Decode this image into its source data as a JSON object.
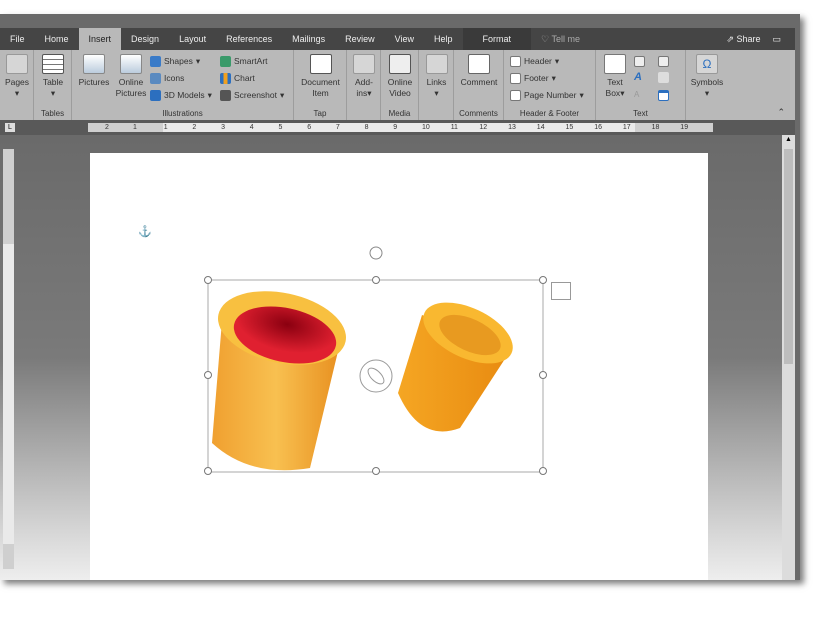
{
  "tabs": [
    "File",
    "Home",
    "Insert",
    "Design",
    "Layout",
    "References",
    "Mailings",
    "Review",
    "View",
    "Help",
    "Format"
  ],
  "active_tab": "Insert",
  "tell_me": "Tell me",
  "share": "Share",
  "ribbon": {
    "pages": {
      "label": "Pages",
      "group": ""
    },
    "tables": {
      "table": "Table",
      "group": "Tables"
    },
    "illustrations": {
      "pictures": "Pictures",
      "online_pictures": "Online Pictures",
      "shapes": "Shapes",
      "icons": "Icons",
      "models": "3D Models",
      "smartart": "SmartArt",
      "chart": "Chart",
      "screenshot": "Screenshot",
      "group": "Illustrations"
    },
    "tap": {
      "document_item": "Document Item",
      "group": "Tap"
    },
    "addins": {
      "label": "Add-ins",
      "group": ""
    },
    "media": {
      "online_video": "Online Video",
      "group": "Media"
    },
    "links": {
      "label": "Links",
      "group": ""
    },
    "comments": {
      "comment": "Comment",
      "group": "Comments"
    },
    "header_footer": {
      "header": "Header",
      "footer": "Footer",
      "page_number": "Page Number",
      "group": "Header & Footer"
    },
    "text": {
      "text_box": "Text Box",
      "group": "Text"
    },
    "symbols": {
      "label": "Symbols",
      "group": ""
    }
  },
  "ruler_ticks": [
    "2",
    "1",
    "1",
    "2",
    "3",
    "4",
    "5",
    "6",
    "7",
    "8",
    "9",
    "10",
    "11",
    "12",
    "13",
    "14",
    "15",
    "16",
    "17",
    "18",
    "19"
  ],
  "colors": {
    "tab_bar": "#454545",
    "ribbon": "#b9b9b9",
    "cylinder": "#f5a623",
    "inner_red": "#d0202a"
  }
}
